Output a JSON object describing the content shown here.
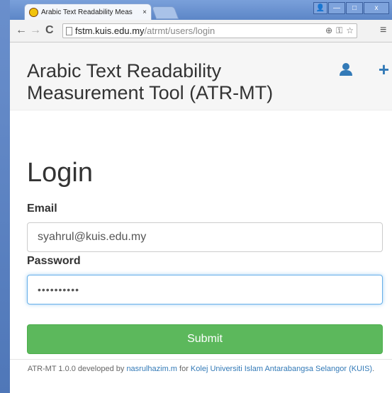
{
  "browser": {
    "tab_title": "Arabic Text Readability Meas",
    "tab_close": "×",
    "url_host": "fstm.kuis.edu.my",
    "url_path": "/atrmt/users/login",
    "win_user": "👤",
    "win_min": "—",
    "win_max": "□",
    "win_close": "x"
  },
  "navbar": {
    "brand": "Arabic Text Readability Measurement Tool (ATR-MT)",
    "plus": "+"
  },
  "form": {
    "title": "Login",
    "email_label": "Email",
    "email_value": "syahrul@kuis.edu.my",
    "password_label": "Password",
    "password_value": "••••••••••",
    "submit_label": "Submit"
  },
  "footer": {
    "prefix": "ATR-MT 1.0.0 developed by ",
    "author": "nasrulhazim.m",
    "middle": " for ",
    "org": "Kolej Universiti Islam Antarabangsa Selangor (KUIS)",
    "suffix": "."
  }
}
